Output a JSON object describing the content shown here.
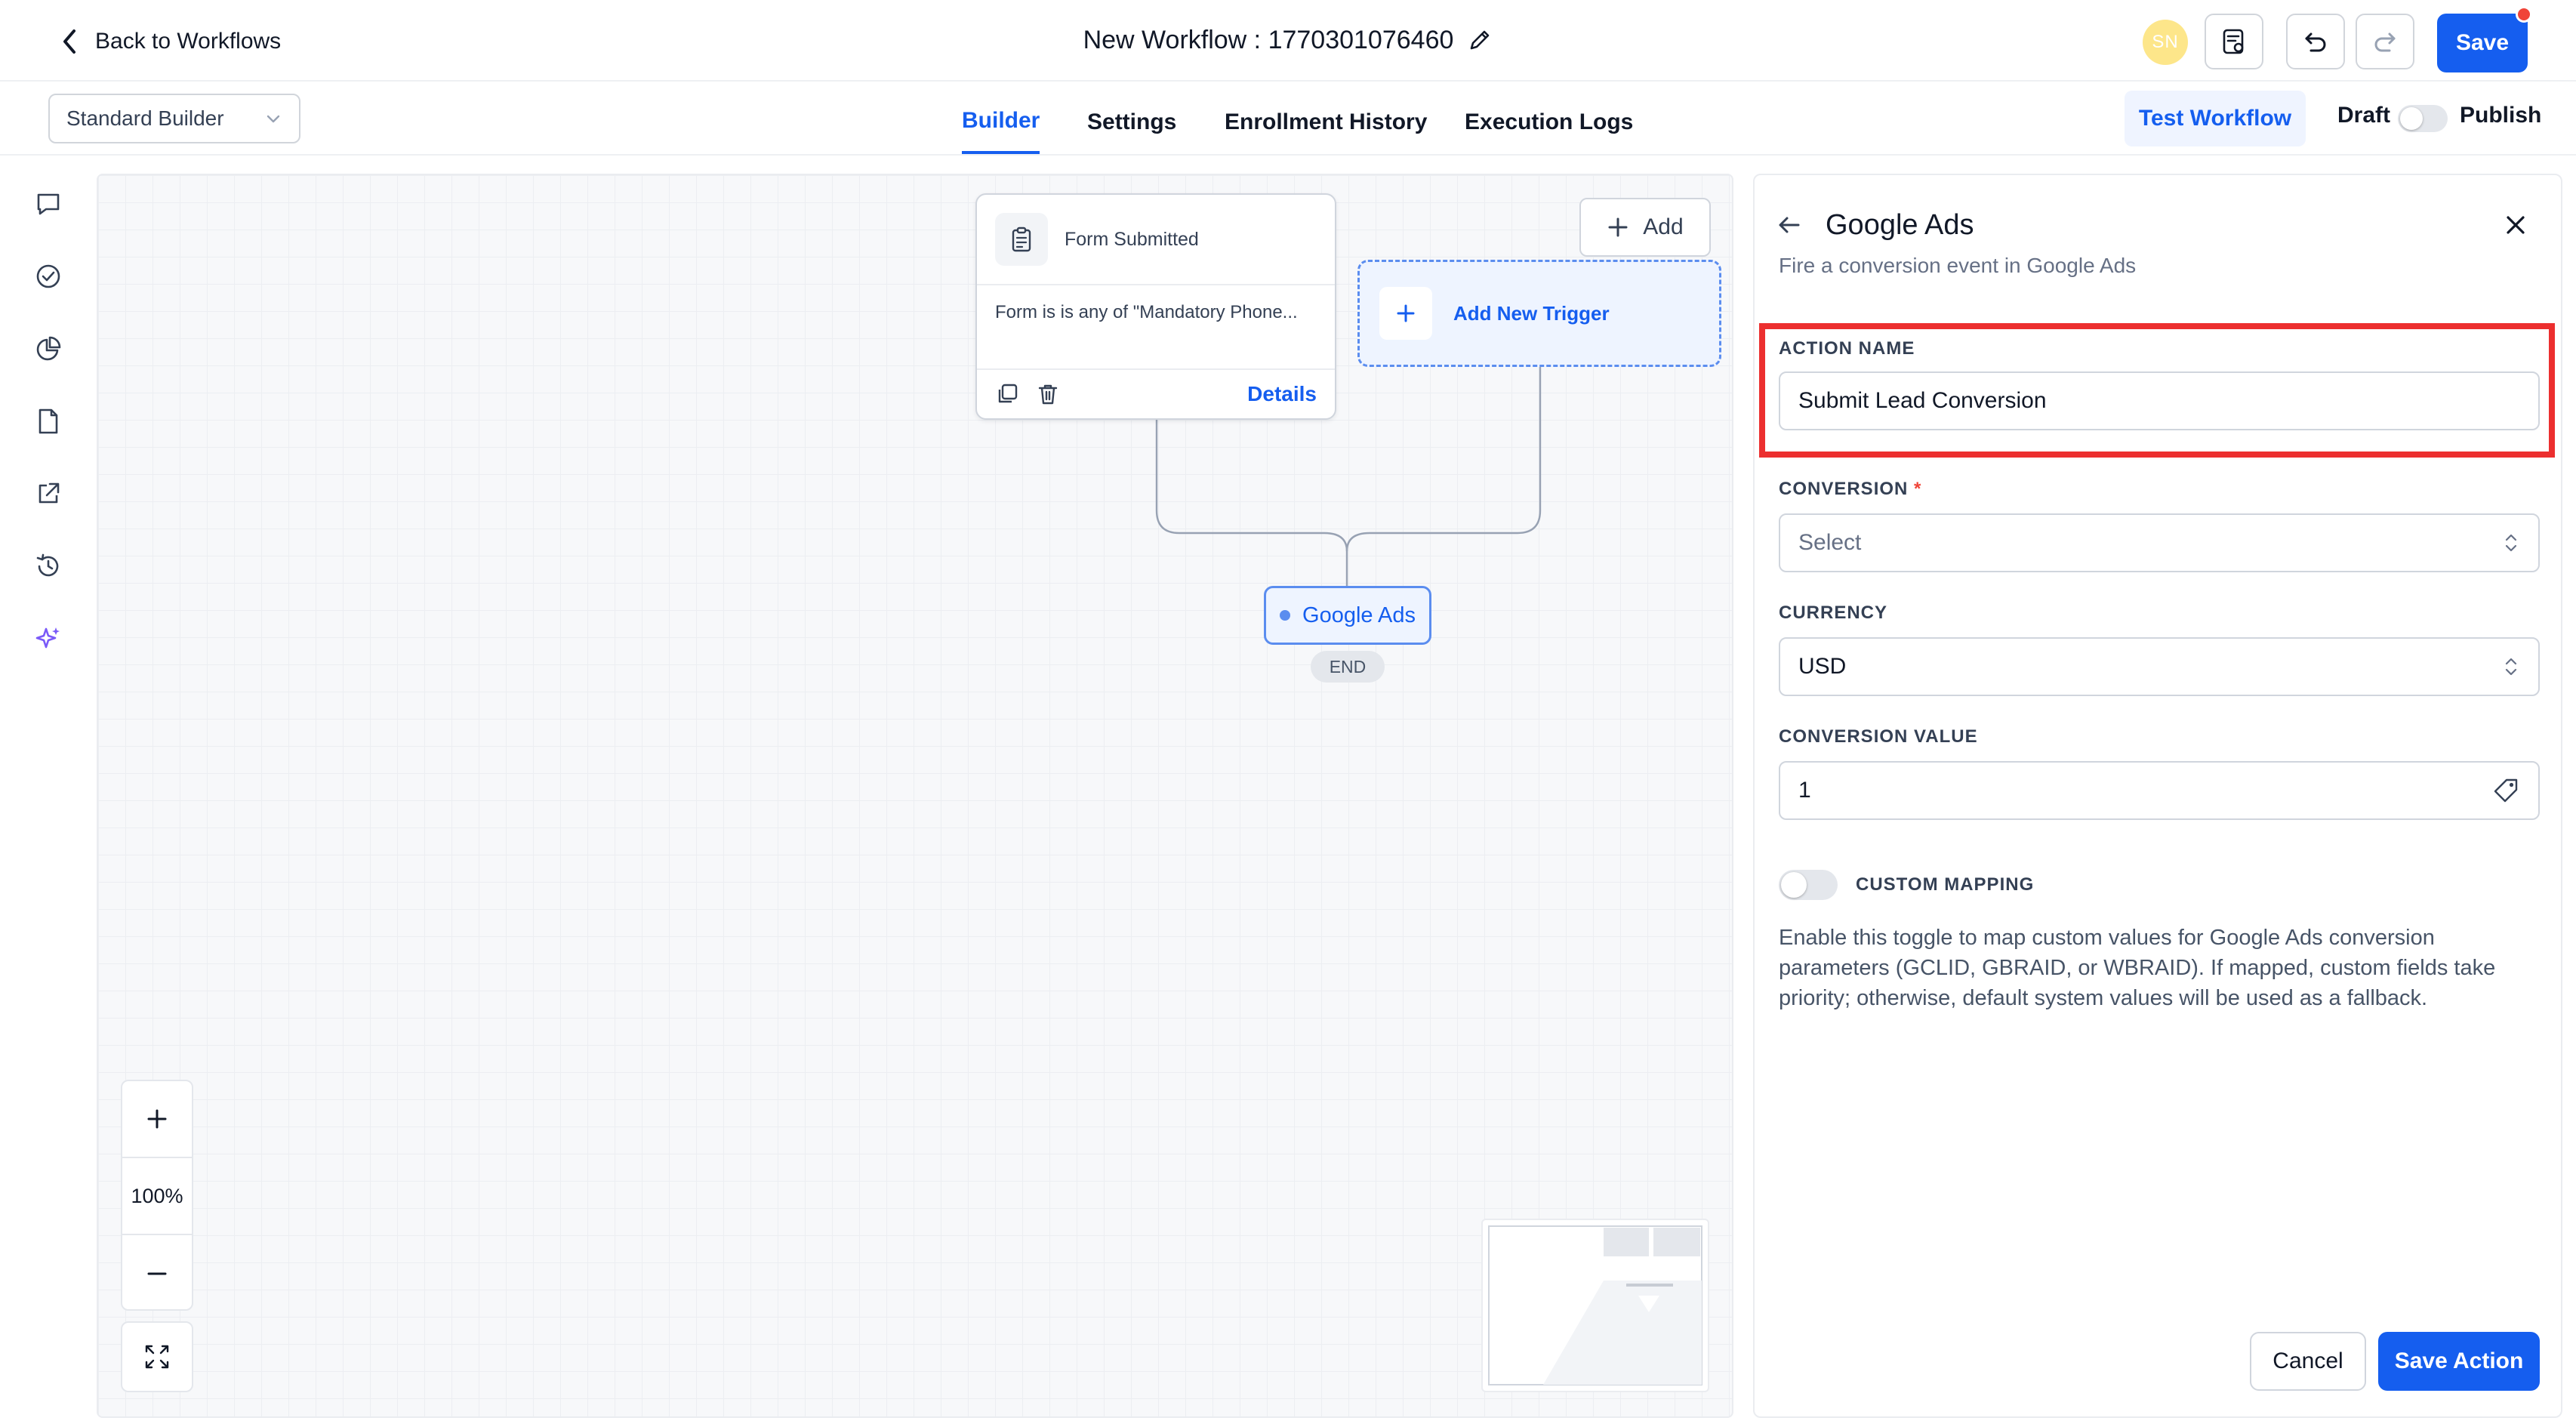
{
  "header": {
    "back_label": "Back to Workflows",
    "workflow_title": "New Workflow : 1770301076460",
    "avatar_initials": "SN",
    "save_label": "Save"
  },
  "subheader": {
    "builder_mode": "Standard Builder",
    "tabs": [
      {
        "label": "Builder",
        "active": true
      },
      {
        "label": "Settings",
        "active": false
      },
      {
        "label": "Enrollment History",
        "active": false
      },
      {
        "label": "Execution Logs",
        "active": false
      }
    ],
    "test_workflow_label": "Test Workflow",
    "draft_label": "Draft",
    "publish_label": "Publish"
  },
  "left_rail": {
    "icons": [
      "chat-icon",
      "check-circle-icon",
      "pie-chart-icon",
      "document-icon",
      "external-link-icon",
      "history-icon",
      "sparkles-icon"
    ]
  },
  "canvas": {
    "trigger_card": {
      "title": "Form Submitted",
      "condition": "Form is is any of \"Mandatory Phone...",
      "details_label": "Details"
    },
    "add_label": "Add",
    "add_trigger_label": "Add New Trigger",
    "action_node_label": "Google Ads",
    "end_label": "END",
    "zoom_level": "100%"
  },
  "panel": {
    "title": "Google Ads",
    "subtitle": "Fire a conversion event in Google Ads",
    "action_name_label": "ACTION NAME",
    "action_name_value": "Submit Lead Conversion",
    "conversion_label": "CONVERSION",
    "required_mark": "*",
    "conversion_placeholder": "Select",
    "currency_label": "CURRENCY",
    "currency_value": "USD",
    "conversion_value_label": "CONVERSION VALUE",
    "conversion_value": "1",
    "custom_mapping_label": "CUSTOM MAPPING",
    "custom_mapping_help": "Enable this toggle to map custom values for Google Ads conversion parameters (GCLID, GBRAID, or WBRAID). If mapped, custom fields take priority; otherwise, default system values will be used as a fallback.",
    "cancel_label": "Cancel",
    "save_action_label": "Save Action"
  },
  "colors": {
    "primary": "#155eef",
    "highlight": "#ec2f2f",
    "avatar": "#fde68a",
    "notification": "#f04438"
  }
}
